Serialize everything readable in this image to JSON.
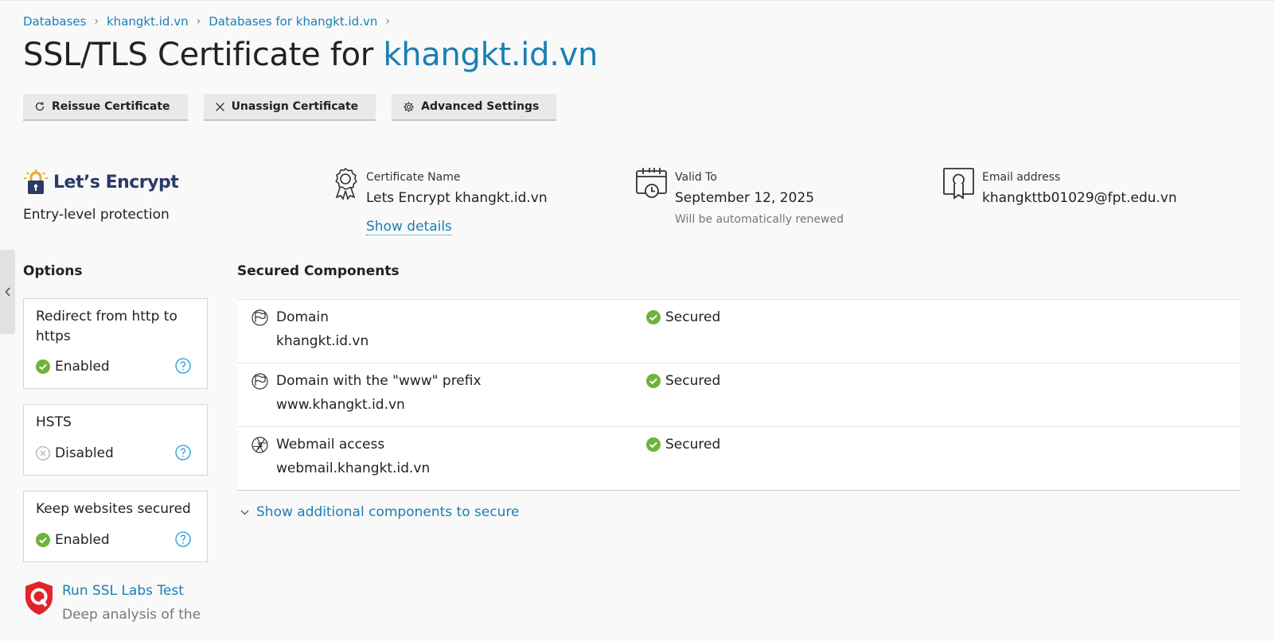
{
  "breadcrumb": [
    {
      "label": "Databases"
    },
    {
      "label": "khangkt.id.vn"
    },
    {
      "label": "Databases for khangkt.id.vn"
    }
  ],
  "page": {
    "title_prefix": "SSL/TLS Certificate for ",
    "title_domain": "khangkt.id.vn"
  },
  "toolbar": {
    "reissue_label": "Reissue Certificate",
    "unassign_label": "Unassign Certificate",
    "advanced_label": "Advanced Settings"
  },
  "brand": {
    "name": "Let’s Encrypt",
    "subtitle": "Entry-level protection"
  },
  "certificate": {
    "name_label": "Certificate Name",
    "name_value": "Lets Encrypt khangkt.id.vn",
    "show_details": "Show details",
    "valid_label": "Valid To",
    "valid_value": "September 12, 2025",
    "valid_note": "Will be automatically renewed",
    "email_label": "Email address",
    "email_value": "khangkttb01029@fpt.edu.vn"
  },
  "options": {
    "heading": "Options",
    "items": [
      {
        "title": "Redirect from http to https",
        "status": "Enabled",
        "state": "enabled"
      },
      {
        "title": "HSTS",
        "status": "Disabled",
        "state": "disabled"
      },
      {
        "title": "Keep websites secured",
        "status": "Enabled",
        "state": "enabled"
      }
    ]
  },
  "ssllabs": {
    "title": "Run SSL Labs Test",
    "desc": "Deep analysis of the"
  },
  "components": {
    "heading": "Secured Components",
    "rows": [
      {
        "name": "Domain",
        "host": "khangkt.id.vn",
        "status": "Secured",
        "icon": "flag-icon"
      },
      {
        "name": "Domain with the \"www\" prefix",
        "host": "www.khangkt.id.vn",
        "status": "Secured",
        "icon": "flag-icon"
      },
      {
        "name": "Webmail access",
        "host": "webmail.khangkt.id.vn",
        "status": "Secured",
        "icon": "aperture-icon"
      }
    ],
    "more_link": "Show additional components to secure"
  },
  "colors": {
    "link": "#1a7fb5",
    "success": "#6fb33a",
    "ssllabs_red": "#e2232b"
  }
}
